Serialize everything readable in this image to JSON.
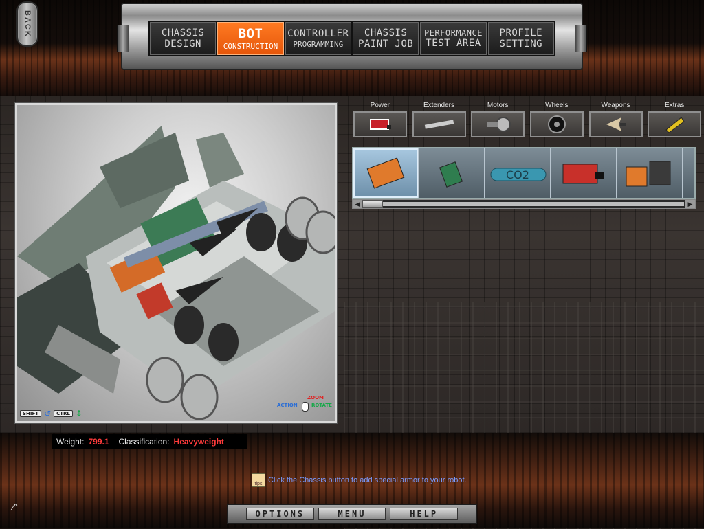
{
  "back": {
    "label": "BACK"
  },
  "nav": {
    "tabs": [
      {
        "line1": "CHASSIS",
        "line2": "DESIGN",
        "active": false
      },
      {
        "line1": "BOT",
        "line2": "CONSTRUCTION",
        "active": true
      },
      {
        "line1": "CONTROLLER",
        "line2": "PROGRAMMING",
        "active": false
      },
      {
        "line1": "CHASSIS",
        "line2": "PAINT JOB",
        "active": false
      },
      {
        "line1": "PERFORMANCE",
        "line2": "TEST AREA",
        "active": false
      },
      {
        "line1": "PROFILE",
        "line2": "SETTING",
        "active": false
      }
    ]
  },
  "viewport": {
    "shift_key": "SHIFT",
    "ctrl_key": "CTRL",
    "zoom_label": "ZOOM",
    "action_label": "ACTION",
    "rotate_label": "ROTATE"
  },
  "categories": [
    {
      "label": "Power",
      "icon": "battery-icon"
    },
    {
      "label": "Extenders",
      "icon": "extender-bar-icon"
    },
    {
      "label": "Motors",
      "icon": "motor-icon"
    },
    {
      "label": "Wheels",
      "icon": "wheel-icon"
    },
    {
      "label": "Weapons",
      "icon": "weapon-blade-icon"
    },
    {
      "label": "Extras",
      "icon": "extras-icon"
    }
  ],
  "parts": [
    {
      "icon": "battery-pack-icon",
      "selected": true
    },
    {
      "icon": "circuit-board-icon",
      "selected": false
    },
    {
      "icon": "co2-tank-icon",
      "selected": false
    },
    {
      "icon": "red-battery-icon",
      "selected": false
    },
    {
      "icon": "battery-bank-icon",
      "selected": false
    }
  ],
  "status": {
    "weight_label": "Weight:",
    "weight_value": "799.1",
    "class_label": "Classification:",
    "class_value": "Heavyweight"
  },
  "tip": {
    "icon_text": "tips",
    "text": "Click the Chassis button to add special armor to your robot."
  },
  "bottom": {
    "options": "OPTIONS",
    "menu": "MENU",
    "help": "HELP"
  },
  "colors": {
    "accent": "#f26a15",
    "value_red": "#ff3b3b",
    "tip_blue": "#7a9bff"
  }
}
